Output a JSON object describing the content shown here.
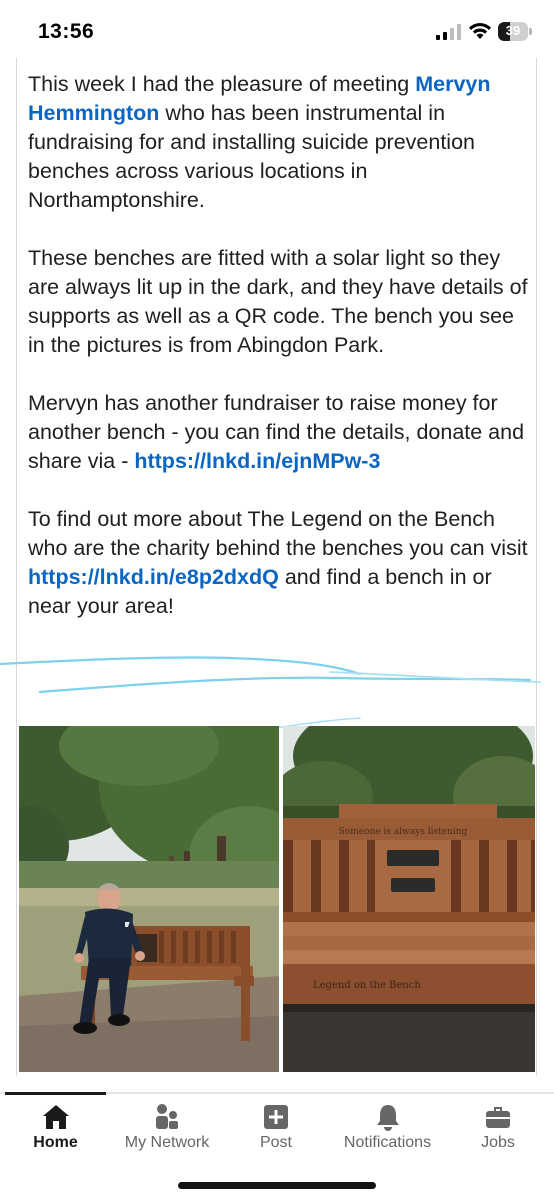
{
  "status_bar": {
    "time": "13:56",
    "battery_percent": "39",
    "battery_level": 0.39
  },
  "post": {
    "paragraph1": {
      "before": "This week I had the pleasure of meeting ",
      "mention": "Mervyn Hemmington",
      "after": " who has been instrumental in fundraising for and installing suicide prevention benches across various locations in Northamptonshire."
    },
    "paragraph2": "These benches are fitted with a solar light so they are always lit up in the dark, and they have details of supports as well as a QR code. The bench you see in the pictures is from Abingdon Park.",
    "paragraph3": {
      "before": "Mervyn has another fundraiser to raise money for another bench - you can find the details, donate and share via - ",
      "link": "https://lnkd.in/ejnMPw-3"
    },
    "paragraph4": {
      "before": "To find out more about The Legend on the Bench who are the charity behind the benches you can visit ",
      "link": "https://lnkd.in/e8p2dxdQ",
      "after": " and find a bench in or near your area!"
    }
  },
  "images": {
    "bench_plaque_top": "Someone is always listening",
    "bench_carving": "Legend on the Bench"
  },
  "bottom_nav": {
    "items": [
      {
        "label": "Home",
        "icon": "home-icon",
        "active": true
      },
      {
        "label": "My Network",
        "icon": "people-icon",
        "active": false
      },
      {
        "label": "Post",
        "icon": "plus-square-icon",
        "active": false
      },
      {
        "label": "Notifications",
        "icon": "bell-icon",
        "active": false
      },
      {
        "label": "Jobs",
        "icon": "briefcase-icon",
        "active": false
      }
    ]
  },
  "colors": {
    "link": "#0a66c2",
    "text": "#1f1f1f",
    "scribble": "#7fd0ea"
  }
}
